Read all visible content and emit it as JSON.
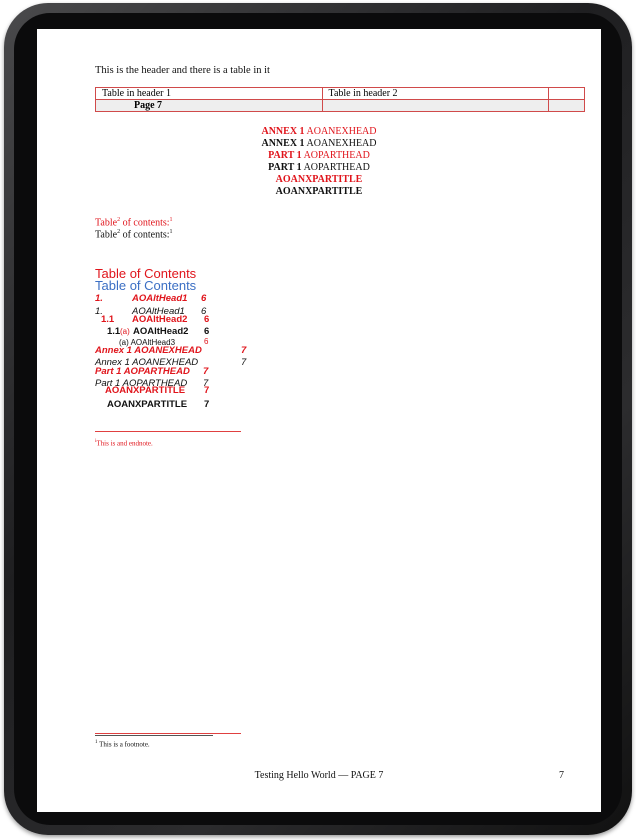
{
  "header": {
    "text": "This is the header and there is a table in it",
    "table_row1": [
      "Table in header 1",
      "Table in header 2",
      ""
    ],
    "table_row2": [
      "Page 7",
      "",
      ""
    ]
  },
  "annex": {
    "line1_bold": "ANNEX 1",
    "line1_rest": "AOANEXHEAD",
    "line2_bold": "ANNEX 1",
    "line2_rest": "AOANEXHEAD",
    "line3_bold": "PART 1",
    "line3_rest": "AOPARTHEAD",
    "line4_bold": "PART 1",
    "line4_rest": "AOPARTHEAD",
    "line5": "AOANXPARTITLE",
    "line6": "AOANXPARTITLE"
  },
  "toc_ref": {
    "red_a": "Table",
    "red_sup1": "2",
    "red_b": " of contents:",
    "red_sup2": "1",
    "blk_a": "Table",
    "blk_sup1": "2",
    "blk_b": " of contents:",
    "blk_sup2": "1"
  },
  "toc": {
    "title_red": "Table of Contents",
    "title_blue": "Table of Contents",
    "entries": [
      {
        "num": "1.",
        "text": "AOAltHead1",
        "page": "6"
      },
      {
        "num": "1.",
        "text": "AOAltHead1",
        "page": "6"
      },
      {
        "num": "1.1",
        "text": "AOAltHead2",
        "page": "6"
      },
      {
        "num": "1.1",
        "text": "AOAltHead2",
        "page": "6"
      },
      {
        "num": "(a)",
        "text": "AOAltHead3",
        "page": "6"
      },
      {
        "num": "(a)",
        "text": "AOAltHead3",
        "page": "6"
      },
      {
        "num": "",
        "text": "Annex 1 AOANEXHEAD",
        "page": "7"
      },
      {
        "num": "",
        "text": "Annex 1 AOANEXHEAD",
        "page": "7"
      },
      {
        "num": "",
        "text": "Part 1 AOPARTHEAD",
        "page": "7"
      },
      {
        "num": "",
        "text": "Part 1 AOPARTHEAD",
        "page": "7"
      },
      {
        "num": "",
        "text": "AOANXPARTITLE",
        "page": "7"
      },
      {
        "num": "",
        "text": "AOANXPARTITLE",
        "page": "7"
      }
    ]
  },
  "endnote": {
    "sup": "i",
    "text": "This is and endnote."
  },
  "footnote": {
    "sup": "1",
    "text": "This is a footnote."
  },
  "footer": {
    "text": "Testing Hello World — PAGE 7",
    "page": "7"
  },
  "colors": {
    "red": "#e0141b",
    "blue": "#3b6fc4",
    "bezel": "#1f1f21"
  }
}
